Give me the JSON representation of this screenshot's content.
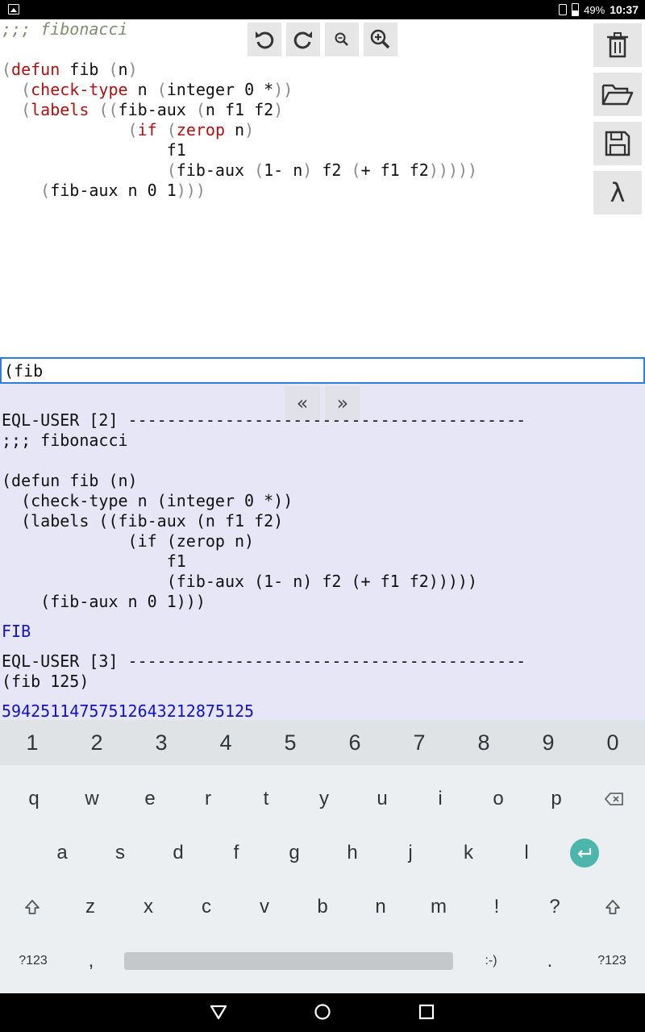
{
  "status_bar": {
    "battery_percent": "49%",
    "time": "10:37"
  },
  "editor": {
    "lines": [
      [
        {
          "t": ";;; fibonacci",
          "c": "comment"
        }
      ],
      [],
      [
        {
          "t": "(",
          "c": "paren"
        },
        {
          "t": "defun",
          "c": "kw"
        },
        {
          "t": " fib ",
          "c": ""
        },
        {
          "t": "(",
          "c": "paren"
        },
        {
          "t": "n",
          "c": ""
        },
        {
          "t": ")",
          "c": "paren"
        }
      ],
      [
        {
          "t": "  ",
          "c": ""
        },
        {
          "t": "(",
          "c": "paren"
        },
        {
          "t": "check-type",
          "c": "kw"
        },
        {
          "t": " n ",
          "c": ""
        },
        {
          "t": "(",
          "c": "paren"
        },
        {
          "t": "integer 0 *",
          "c": ""
        },
        {
          "t": "))",
          "c": "paren"
        }
      ],
      [
        {
          "t": "  ",
          "c": ""
        },
        {
          "t": "(",
          "c": "paren"
        },
        {
          "t": "labels",
          "c": "kw"
        },
        {
          "t": " ",
          "c": ""
        },
        {
          "t": "((",
          "c": "paren"
        },
        {
          "t": "fib-aux ",
          "c": ""
        },
        {
          "t": "(",
          "c": "paren"
        },
        {
          "t": "n f1 f2",
          "c": ""
        },
        {
          "t": ")",
          "c": "paren"
        }
      ],
      [
        {
          "t": "             ",
          "c": ""
        },
        {
          "t": "(",
          "c": "paren"
        },
        {
          "t": "if",
          "c": "kw"
        },
        {
          "t": " ",
          "c": ""
        },
        {
          "t": "(",
          "c": "paren"
        },
        {
          "t": "zerop",
          "c": "kw"
        },
        {
          "t": " n",
          "c": ""
        },
        {
          "t": ")",
          "c": "paren"
        }
      ],
      [
        {
          "t": "                 f1",
          "c": ""
        }
      ],
      [
        {
          "t": "                 ",
          "c": ""
        },
        {
          "t": "(",
          "c": "paren"
        },
        {
          "t": "fib-aux ",
          "c": ""
        },
        {
          "t": "(",
          "c": "paren"
        },
        {
          "t": "1- n",
          "c": ""
        },
        {
          "t": ")",
          "c": "paren"
        },
        {
          "t": " f2 ",
          "c": ""
        },
        {
          "t": "(",
          "c": "paren"
        },
        {
          "t": "+ f1 f2",
          "c": ""
        },
        {
          "t": ")))))",
          "c": "paren"
        }
      ],
      [
        {
          "t": "    ",
          "c": ""
        },
        {
          "t": "(",
          "c": "paren"
        },
        {
          "t": "fib-aux n 0 1",
          "c": ""
        },
        {
          "t": ")))",
          "c": "paren"
        }
      ]
    ]
  },
  "toolbar": {
    "undo_icon": "undo-icon",
    "redo_icon": "redo-icon",
    "zoom_out_icon": "zoom-out-icon",
    "zoom_in_icon": "zoom-in-icon"
  },
  "side_toolbar": {
    "delete_icon": "trash-icon",
    "open_icon": "folder-open-icon",
    "save_icon": "save-icon",
    "lambda_label": "λ"
  },
  "command_line": {
    "value": "(fib "
  },
  "history": {
    "back_label": "«",
    "forward_label": "»"
  },
  "output": {
    "lines": [
      {
        "t": "EQL-USER [2] -----------------------------------------",
        "c": ""
      },
      {
        "t": ";;; fibonacci",
        "c": ""
      },
      {
        "t": "",
        "c": ""
      },
      {
        "t": "(defun fib (n)",
        "c": ""
      },
      {
        "t": "  (check-type n (integer 0 *))",
        "c": ""
      },
      {
        "t": "  (labels ((fib-aux (n f1 f2)",
        "c": ""
      },
      {
        "t": "             (if (zerop n)",
        "c": ""
      },
      {
        "t": "                 f1",
        "c": ""
      },
      {
        "t": "                 (fib-aux (1- n) f2 (+ f1 f2)))))",
        "c": ""
      },
      {
        "t": "    (fib-aux n 0 1)))",
        "c": ""
      },
      {
        "t": "",
        "c": "gap"
      },
      {
        "t": "FIB",
        "c": "blue"
      },
      {
        "t": "",
        "c": "gap"
      },
      {
        "t": "EQL-USER [3] -----------------------------------------",
        "c": ""
      },
      {
        "t": "(fib 125)",
        "c": ""
      },
      {
        "t": "",
        "c": "gap"
      },
      {
        "t": "59425114757512643212875125",
        "c": "blue"
      }
    ]
  },
  "keyboard": {
    "numbers": [
      "1",
      "2",
      "3",
      "4",
      "5",
      "6",
      "7",
      "8",
      "9",
      "0"
    ],
    "row1": [
      "q",
      "w",
      "e",
      "r",
      "t",
      "y",
      "u",
      "i",
      "o",
      "p"
    ],
    "row2": [
      "a",
      "s",
      "d",
      "f",
      "g",
      "h",
      "j",
      "k",
      "l"
    ],
    "row3": [
      "z",
      "x",
      "c",
      "v",
      "b",
      "n",
      "m",
      "!",
      "?"
    ],
    "sym_label": "?123",
    "comma": ",",
    "smiley": ":-)",
    "period": "."
  }
}
